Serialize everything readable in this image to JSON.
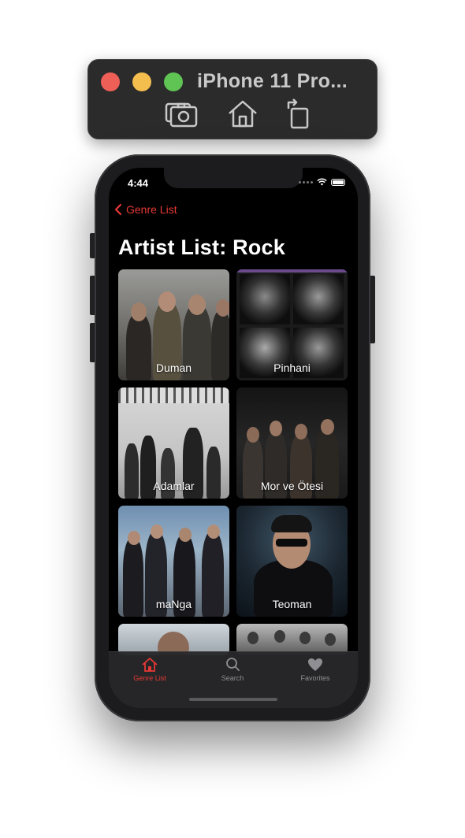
{
  "toolbar": {
    "title": "iPhone 11 Pro...",
    "buttons": [
      "screenshot-icon",
      "home-icon",
      "rotate-icon"
    ]
  },
  "status_bar": {
    "time": "4:44"
  },
  "nav": {
    "back_label": "Genre List"
  },
  "page": {
    "title": "Artist List: Rock"
  },
  "artists": [
    {
      "name": "Duman"
    },
    {
      "name": "Pinhani"
    },
    {
      "name": "Adamlar"
    },
    {
      "name": "Mor ve Ötesi"
    },
    {
      "name": "maNga"
    },
    {
      "name": "Teoman"
    }
  ],
  "tabs": [
    {
      "label": "Genre List",
      "icon": "home-icon",
      "active": true
    },
    {
      "label": "Search",
      "icon": "search-icon",
      "active": false
    },
    {
      "label": "Favorites",
      "icon": "heart-icon",
      "active": false
    }
  ],
  "colors": {
    "accent": "#e53935",
    "background": "#000000",
    "inactive_tab": "#8e8e93"
  }
}
